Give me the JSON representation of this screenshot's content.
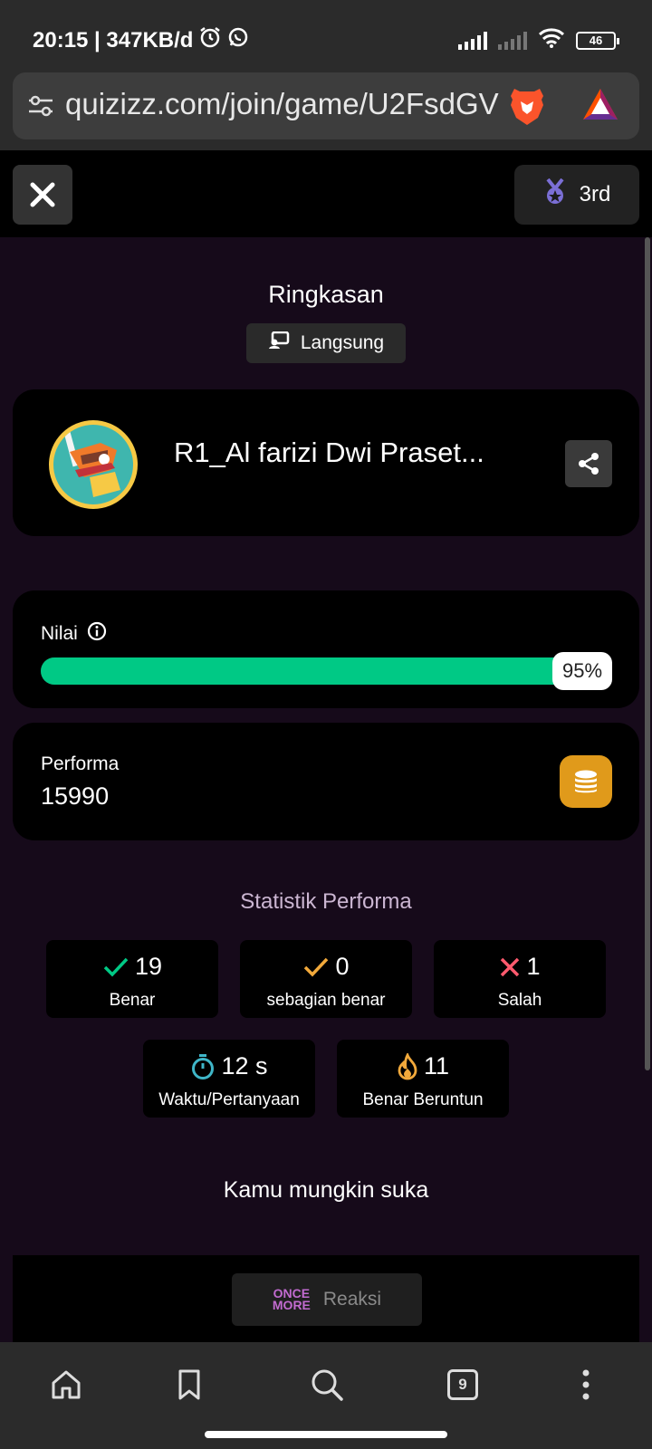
{
  "status_bar": {
    "time_speed": "20:15 | 347KB/d",
    "battery": "46",
    "icons": [
      "alarm-icon",
      "whatsapp-icon",
      "signal-icon",
      "wifi-icon",
      "battery-icon"
    ]
  },
  "browser": {
    "url": "quizizz.com/join/game/U2FsdGVkX1",
    "icons": [
      "site-settings-icon",
      "brave-shields-icon",
      "brave-rewards-icon"
    ]
  },
  "quiz_header": {
    "rank": "3rd"
  },
  "summary": {
    "title": "Ringkasan",
    "mode_badge": "Langsung"
  },
  "player": {
    "name": "R1_Al farizi Dwi Praset..."
  },
  "score": {
    "label": "Nilai",
    "percent_text": "95%",
    "percent": 95
  },
  "performance": {
    "label": "Performa",
    "value": "15990"
  },
  "stats": {
    "title": "Statistik Performa",
    "items": [
      {
        "value": "19",
        "label": "Benar"
      },
      {
        "value": "0",
        "label": "sebagian benar"
      },
      {
        "value": "1",
        "label": "Salah"
      },
      {
        "value": "12 s",
        "label": "Waktu/Pertanyaan"
      },
      {
        "value": "11",
        "label": "Benar Beruntun"
      }
    ]
  },
  "suggestions": {
    "title": "Kamu mungkin suka"
  },
  "reaction": {
    "logo_text": "ONCE MORE",
    "label": "Reaksi"
  },
  "bottom_nav": {
    "tab_count": "9"
  },
  "colors": {
    "green": "#00c985",
    "orange": "#f2a93b",
    "red": "#ff5a6e",
    "teal": "#3fb6c8",
    "purple_bg": "#160a1a"
  }
}
